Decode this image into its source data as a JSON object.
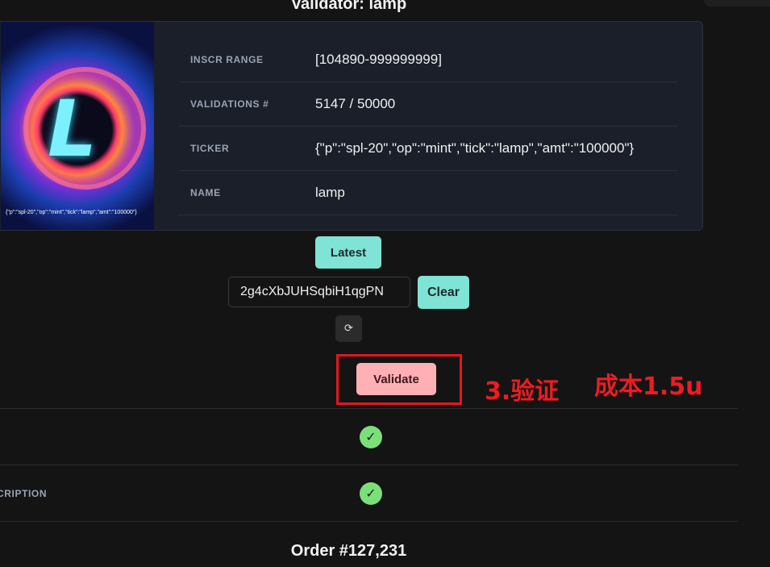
{
  "page": {
    "title": "Validator: lamp"
  },
  "token_card": {
    "image_caption": "{\"p\":\"spl-20\",\"op\":\"mint\",\"tick\":\"lamp\",\"amt\":\"100000\"}",
    "rows": [
      {
        "label": "INSCR RANGE",
        "value": "[104890-999999999]"
      },
      {
        "label": "VALIDATIONS #",
        "value": "5147 / 50000"
      },
      {
        "label": "TICKER",
        "value": "{\"p\":\"spl-20\",\"op\":\"mint\",\"tick\":\"lamp\",\"amt\":\"100000\"}"
      },
      {
        "label": "NAME",
        "value": "lamp"
      }
    ]
  },
  "controls": {
    "latest_label": "Latest",
    "address_value": "2g4cXbJUHSqbiH1qgPN",
    "clear_label": "Clear",
    "refresh_icon": "refresh-icon",
    "validate_label": "Validate"
  },
  "annotations": {
    "step": "3.验证",
    "cost": "成本1.5u",
    "color": "#ef1b22"
  },
  "checks": [
    {
      "label": "",
      "status": "check-icon"
    },
    {
      "label": "CRIPTION",
      "status": "check-icon"
    }
  ],
  "order": {
    "title": "Order #127,231"
  },
  "colors": {
    "accent": "#7fe3d6",
    "validate": "#ffb0b4",
    "success": "#7ce07a"
  }
}
